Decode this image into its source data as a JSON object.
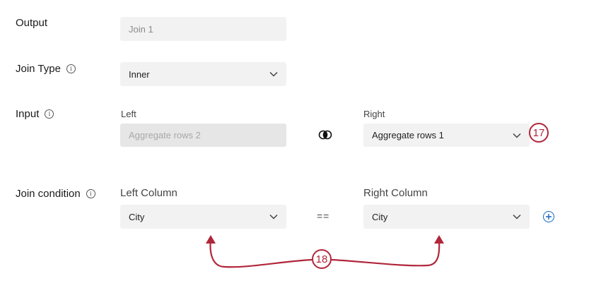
{
  "output": {
    "label": "Output",
    "value": "Join 1"
  },
  "join_type": {
    "label": "Join Type",
    "selected": "Inner",
    "info_icon": "info-icon"
  },
  "input": {
    "label": "Input",
    "left_label": "Left",
    "left_value": "Aggregate rows 2",
    "right_label": "Right",
    "right_value": "Aggregate rows 1",
    "join_icon": "venn-join-icon"
  },
  "join_condition": {
    "label": "Join condition",
    "left_column_label": "Left Column",
    "left_column_value": "City",
    "operator": "==",
    "right_column_label": "Right Column",
    "right_column_value": "City",
    "add_icon": "add-circle-icon"
  },
  "callouts": {
    "right_input": "17",
    "columns": "18"
  },
  "colors": {
    "callout": "#b0263a",
    "accent": "#1565c0",
    "field_bg": "#f2f2f2"
  }
}
